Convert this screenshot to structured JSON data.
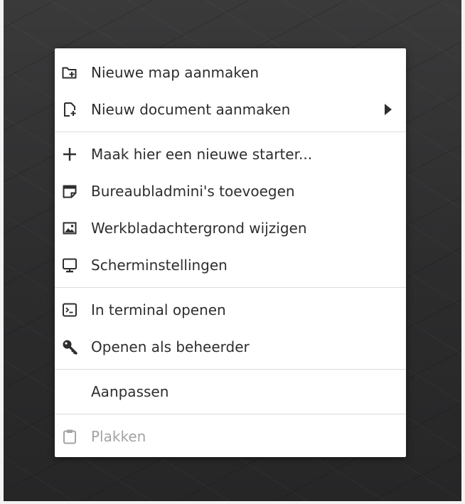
{
  "menu": {
    "items": [
      {
        "label": "Nieuwe map aanmaken",
        "icon": "folder-new-icon"
      },
      {
        "label": "Nieuw document aanmaken",
        "icon": "document-new-icon",
        "submenu": true
      },
      {
        "label": "Maak hier een nieuwe starter...",
        "icon": "plus-icon"
      },
      {
        "label": "Bureaubladmini's toevoegen",
        "icon": "sticky-note-icon"
      },
      {
        "label": "Werkbladachtergrond wijzigen",
        "icon": "image-icon"
      },
      {
        "label": "Scherminstellingen",
        "icon": "monitor-icon"
      },
      {
        "label": "In terminal openen",
        "icon": "terminal-icon"
      },
      {
        "label": "Openen als beheerder",
        "icon": "key-icon"
      },
      {
        "label": "Aanpassen",
        "icon": ""
      },
      {
        "label": "Plakken",
        "icon": "clipboard-icon",
        "disabled": true
      }
    ]
  },
  "colors": {
    "menu_background": "#ffffff",
    "text": "#2e2e2e",
    "disabled_text": "#a3a3a3",
    "separator": "#dcdcdc",
    "desktop": "#2f2f30"
  }
}
